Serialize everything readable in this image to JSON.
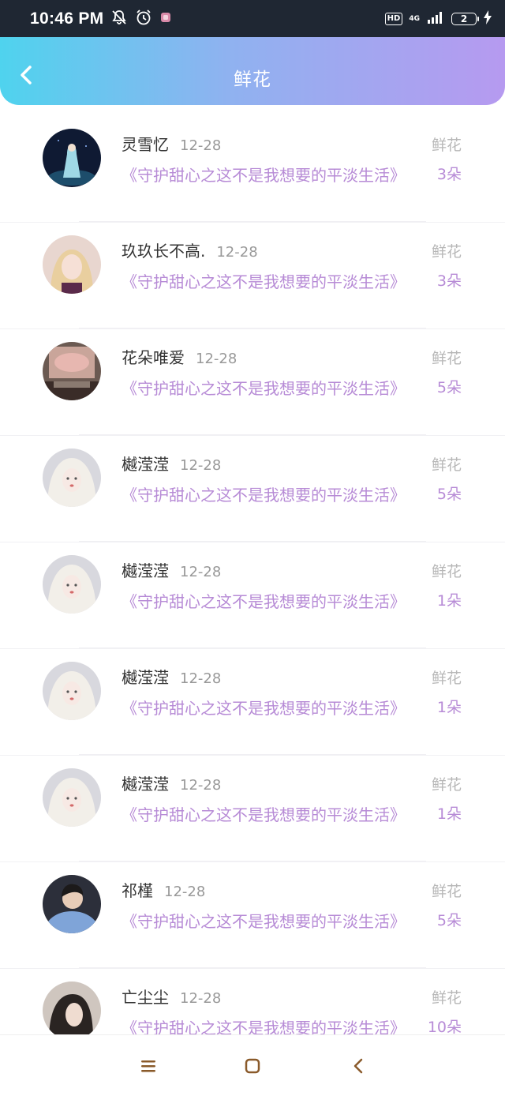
{
  "status_bar": {
    "time": "10:46 PM",
    "hd": "HD",
    "network": "4G",
    "battery": "2"
  },
  "header": {
    "title": "鲜花",
    "back_icon": "chevron-left-icon"
  },
  "colors": {
    "header_gradient_start": "#4fd3ee",
    "header_gradient_end": "#b69af0",
    "accent_purple": "#b78bd6",
    "muted_gray": "#b7b7b7",
    "status_bar_bg": "#1f2733"
  },
  "list": [
    {
      "name": "灵雪忆",
      "date": "12-28",
      "book": "《守护甜心之这不是我想要的平淡生活》",
      "type": "鲜花",
      "amount": "3朵"
    },
    {
      "name": "玖玖长不高.",
      "date": "12-28",
      "book": "《守护甜心之这不是我想要的平淡生活》",
      "type": "鲜花",
      "amount": "3朵"
    },
    {
      "name": "花朵唯爱",
      "date": "12-28",
      "book": "《守护甜心之这不是我想要的平淡生活》",
      "type": "鲜花",
      "amount": "5朵"
    },
    {
      "name": "樾滢滢",
      "date": "12-28",
      "book": "《守护甜心之这不是我想要的平淡生活》",
      "type": "鲜花",
      "amount": "5朵"
    },
    {
      "name": "樾滢滢",
      "date": "12-28",
      "book": "《守护甜心之这不是我想要的平淡生活》",
      "type": "鲜花",
      "amount": "1朵"
    },
    {
      "name": "樾滢滢",
      "date": "12-28",
      "book": "《守护甜心之这不是我想要的平淡生活》",
      "type": "鲜花",
      "amount": "1朵"
    },
    {
      "name": "樾滢滢",
      "date": "12-28",
      "book": "《守护甜心之这不是我想要的平淡生活》",
      "type": "鲜花",
      "amount": "1朵"
    },
    {
      "name": "祁槿",
      "date": "12-28",
      "book": "《守护甜心之这不是我想要的平淡生活》",
      "type": "鲜花",
      "amount": "5朵"
    },
    {
      "name": "亡尘尘",
      "date": "12-28",
      "book": "《守护甜心之这不是我想要的平淡生活》",
      "type": "鲜花",
      "amount": "10朵"
    }
  ],
  "nav": {
    "menu_icon": "menu-icon",
    "home_icon": "home-square-icon",
    "back_icon": "back-triangle-icon"
  }
}
